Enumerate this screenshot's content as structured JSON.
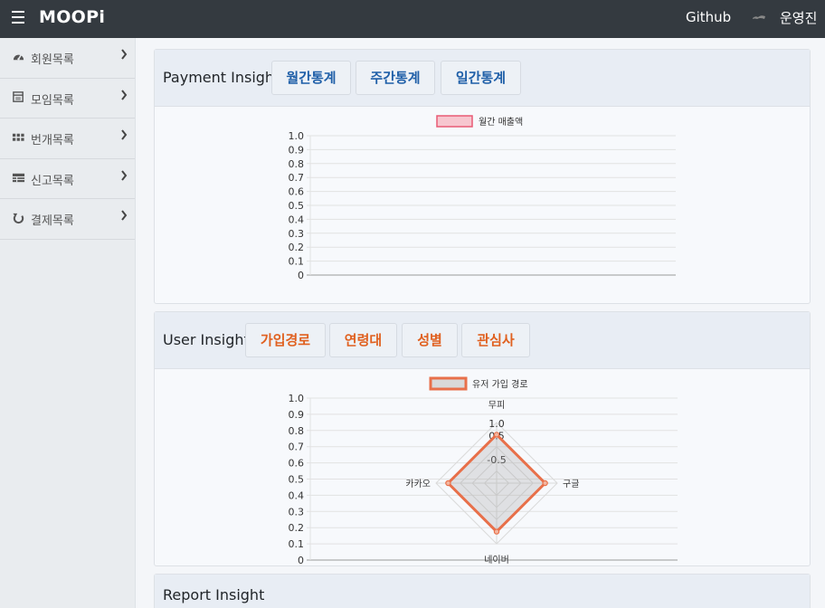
{
  "navbar": {
    "brand": "MOOPi",
    "github": "Github",
    "user": "운영진",
    "icons": {
      "menu": "hamburger-icon",
      "avatar": "avatar-icon"
    }
  },
  "sidebar": {
    "items": [
      {
        "label": "회원목록",
        "icon": "dashboard-icon"
      },
      {
        "label": "모임목록",
        "icon": "calendar-icon"
      },
      {
        "label": "번개목록",
        "icon": "grid-icon"
      },
      {
        "label": "신고목록",
        "icon": "table-icon"
      },
      {
        "label": "결제목록",
        "icon": "refresh-icon"
      }
    ]
  },
  "payment": {
    "title": "Payment Insight",
    "tabs": [
      "월간통계",
      "주간통계",
      "일간통계"
    ],
    "accent": "#1f5fa8"
  },
  "user": {
    "title": "User Insight",
    "tabs": [
      "가입경로",
      "연령대",
      "성별",
      "관심사"
    ],
    "accent": "#e0601f"
  },
  "report": {
    "title": "Report Insight"
  },
  "chart_data": [
    {
      "type": "line",
      "legend": [
        "월간 매출액"
      ],
      "legend_color": "#f7c6cf",
      "legend_border": "#e85a75",
      "ylim": [
        0,
        1.0
      ],
      "yticks": [
        "0",
        "0.1",
        "0.2",
        "0.3",
        "0.4",
        "0.5",
        "0.6",
        "0.7",
        "0.8",
        "0.9",
        "1.0"
      ],
      "series": [
        {
          "name": "월간 매출액",
          "values": []
        }
      ],
      "grid": true,
      "legend_position": "top"
    },
    {
      "type": "radar",
      "legend": [
        "유저 가입 경로"
      ],
      "legend_color": "#d9d9d9",
      "legend_border": "#e8704a",
      "categories": [
        "무피",
        "구글",
        "네이버",
        "카카오"
      ],
      "series": [
        {
          "name": "유저 가입 경로",
          "values": [
            0.5,
            0.5,
            0.5,
            0.5
          ]
        }
      ],
      "r_ticks": [
        "-0.5",
        "0.5",
        "1.0"
      ],
      "r_range": [
        -1.5,
        1.0
      ],
      "cartesian_yticks": [
        "0",
        "0.1",
        "0.2",
        "0.3",
        "0.4",
        "0.5",
        "0.6",
        "0.7",
        "0.8",
        "0.9",
        "1.0"
      ],
      "grid": true,
      "legend_position": "top"
    }
  ]
}
